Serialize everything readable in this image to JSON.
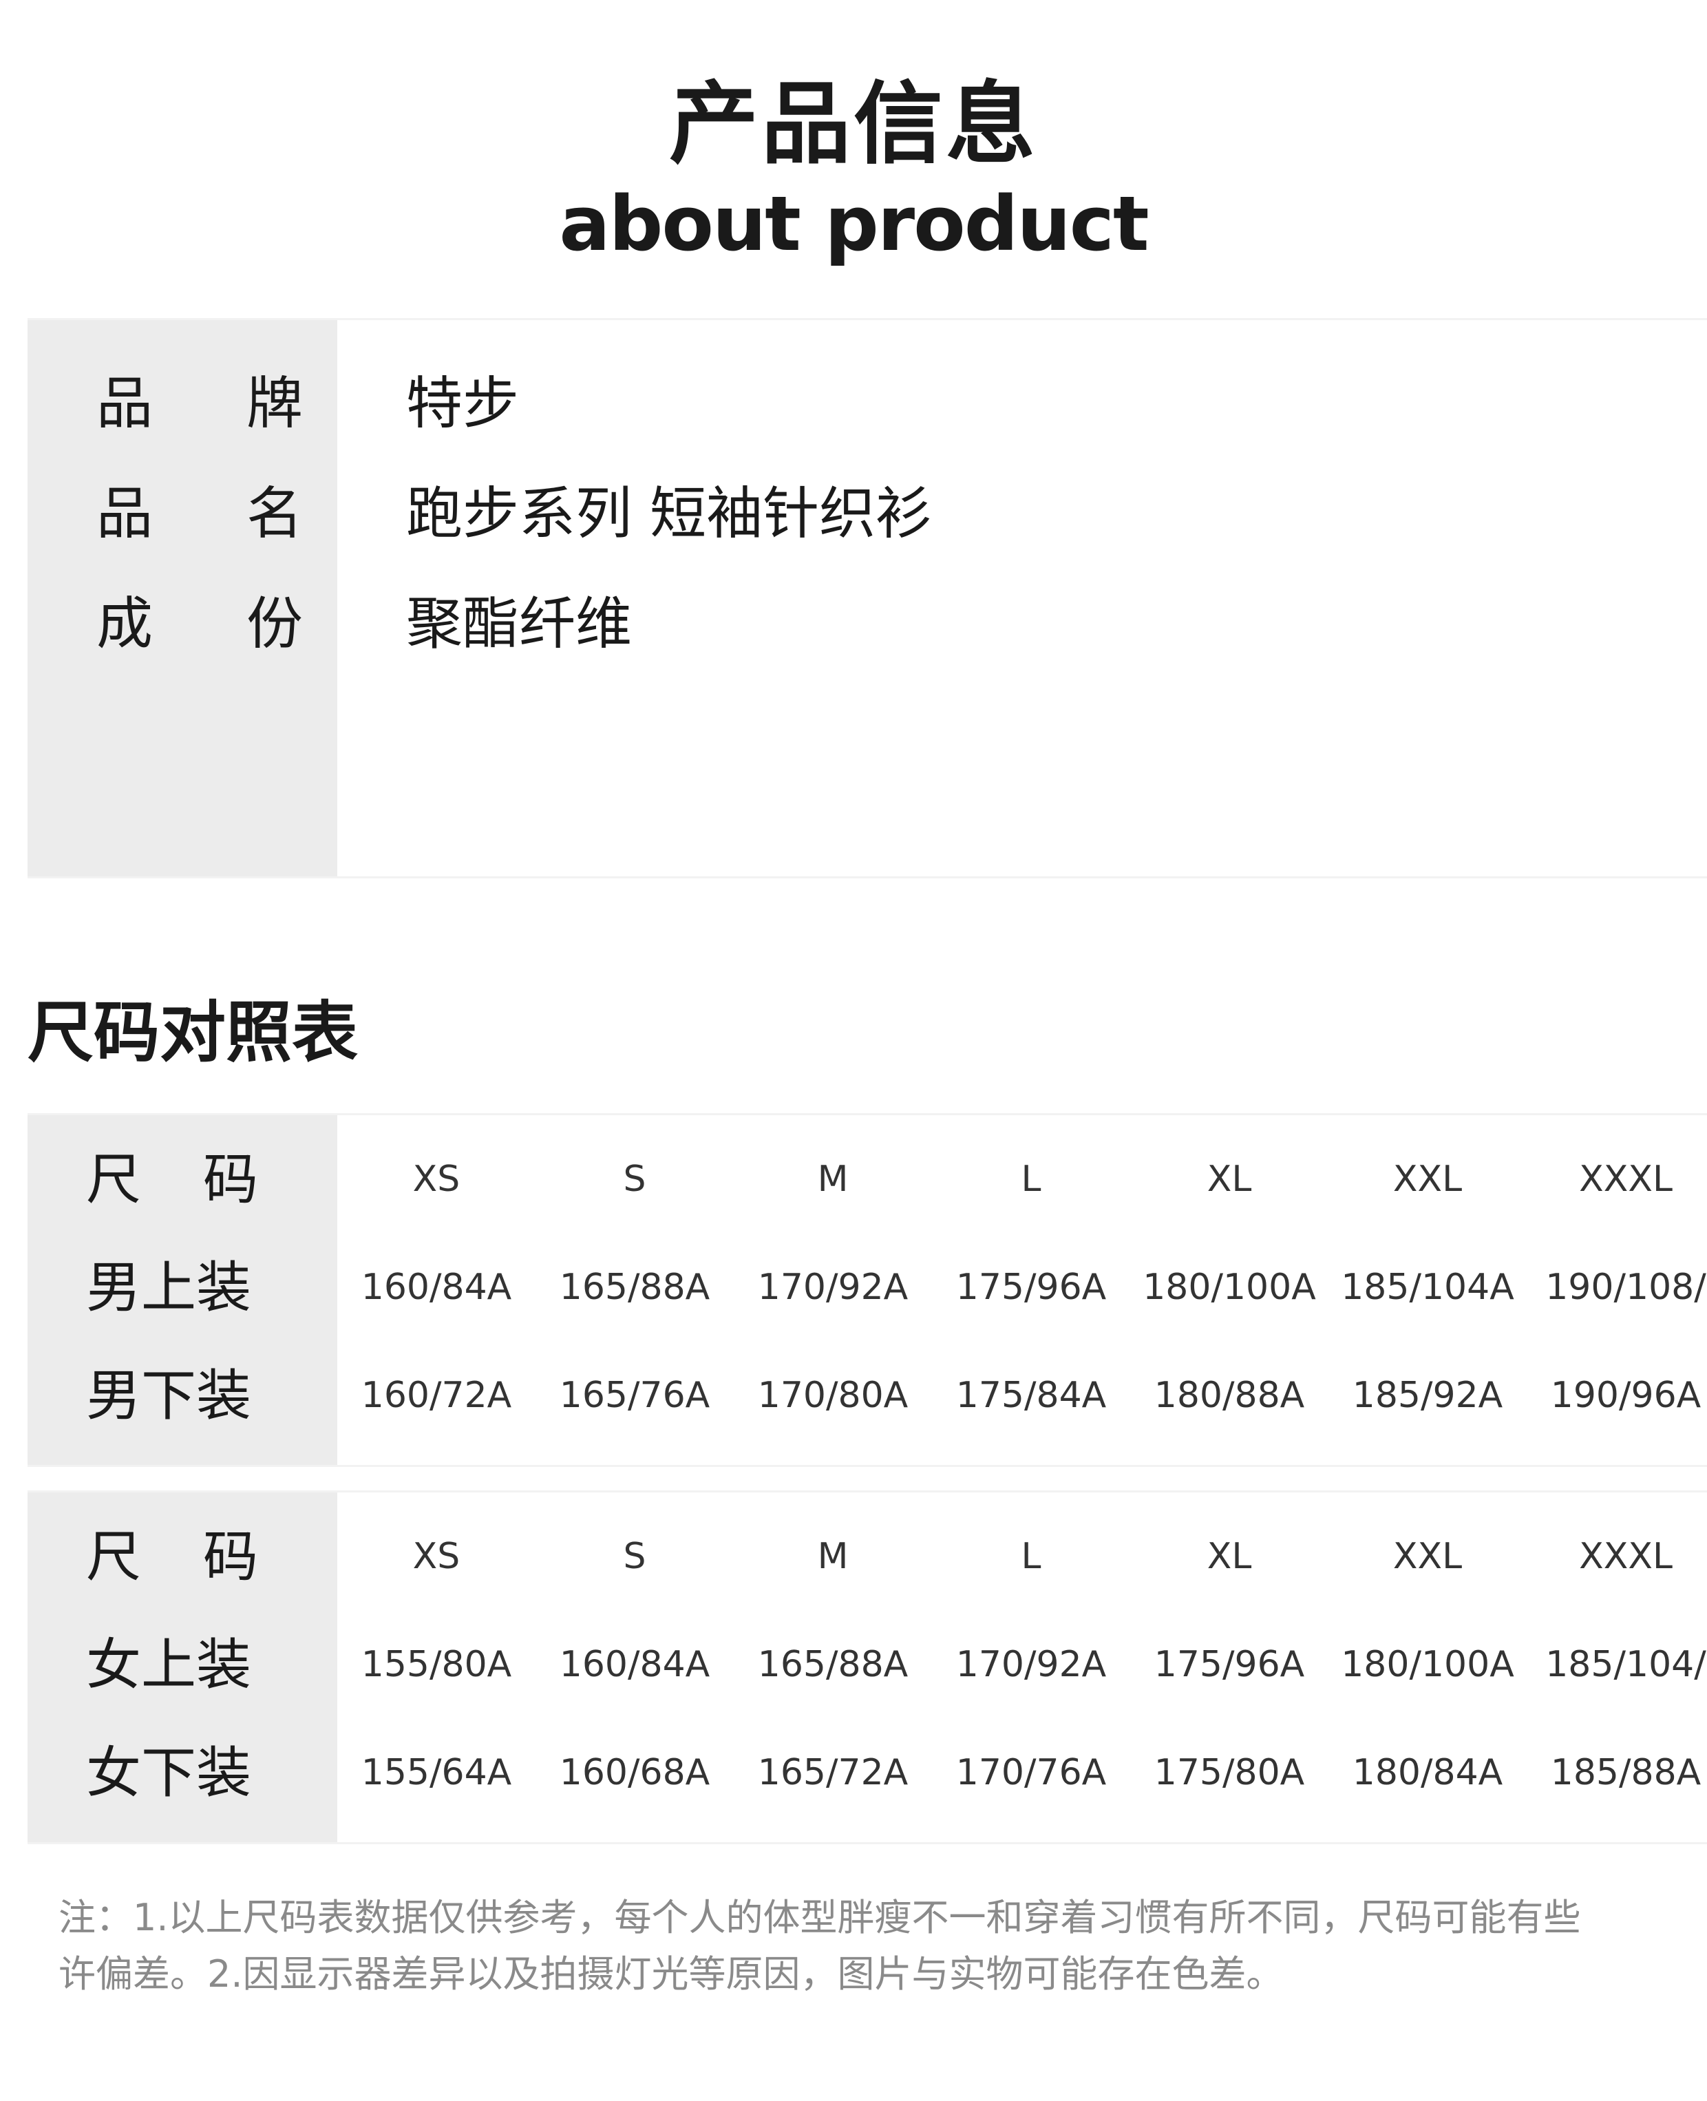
{
  "header": {
    "title_cn": "产品信息",
    "title_en": "about product"
  },
  "product_info": [
    {
      "key_a": "品",
      "key_b": "牌",
      "value": "特步"
    },
    {
      "key_a": "品",
      "key_b": "名",
      "value": "跑步系列 短袖针织衫"
    },
    {
      "key_a": "成",
      "key_b": "份",
      "value": "聚酯纤维"
    }
  ],
  "size_section_title": "尺码对照表",
  "men_table": {
    "header": {
      "key_a": "尺",
      "key_b": "码",
      "cells": [
        "XS",
        "S",
        "M",
        "L",
        "XL",
        "XXL",
        "XXXL"
      ]
    },
    "rows": [
      {
        "label": "男上装",
        "cells": [
          "160/84A",
          "165/88A",
          "170/92A",
          "175/96A",
          "180/100A",
          "185/104A",
          "190/108/"
        ]
      },
      {
        "label": "男下装",
        "cells": [
          "160/72A",
          "165/76A",
          "170/80A",
          "175/84A",
          "180/88A",
          "185/92A",
          "190/96A"
        ]
      }
    ]
  },
  "women_table": {
    "header": {
      "key_a": "尺",
      "key_b": "码",
      "cells": [
        "XS",
        "S",
        "M",
        "L",
        "XL",
        "XXL",
        "XXXL"
      ]
    },
    "rows": [
      {
        "label": "女上装",
        "cells": [
          "155/80A",
          "160/84A",
          "165/88A",
          "170/92A",
          "175/96A",
          "180/100A",
          "185/104/"
        ]
      },
      {
        "label": "女下装",
        "cells": [
          "155/64A",
          "160/68A",
          "165/72A",
          "170/76A",
          "175/80A",
          "180/84A",
          "185/88A"
        ]
      }
    ]
  },
  "note": {
    "line1": "注：1.以上尺码表数据仅供参考，每个人的体型胖瘦不一和穿着习惯有所不同，尺码可能有些",
    "line2": "许偏差。2.因显示器差异以及拍摄灯光等原因，图片与实物可能存在色差。"
  }
}
